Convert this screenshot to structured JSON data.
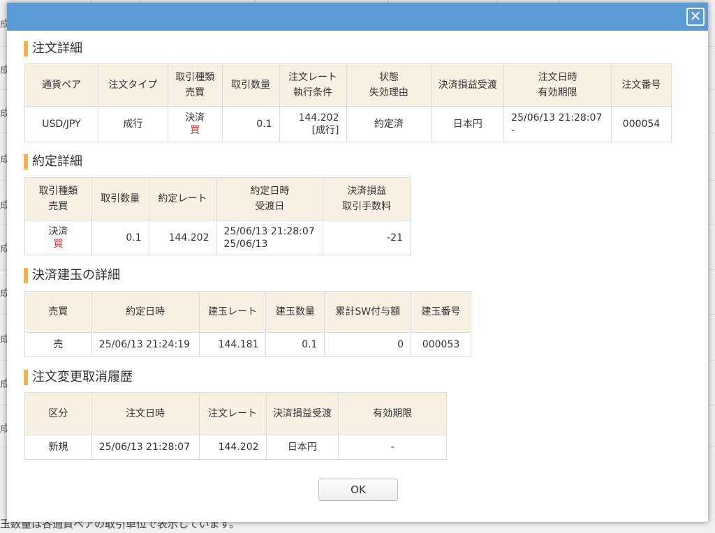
{
  "modal": {
    "close_glyph": "✕",
    "ok_label": "OK"
  },
  "background": {
    "left_glyph": "成",
    "footer_text": "玉数量は各通貨ペアの取引単位で表示しています。"
  },
  "order_detail": {
    "title": "注文詳細",
    "headers": [
      [
        "通貨ペア"
      ],
      [
        "注文タイプ"
      ],
      [
        "取引種類",
        "売買"
      ],
      [
        "取引数量"
      ],
      [
        "注文レート",
        "執行条件"
      ],
      [
        "状態",
        "失効理由"
      ],
      [
        "決済損益受渡"
      ],
      [
        "注文日時",
        "有効期限"
      ],
      [
        "注文番号"
      ]
    ],
    "row": {
      "pair": "USD/JPY",
      "type": "成行",
      "trade_kind": "決済",
      "side": "買",
      "quantity": "0.1",
      "rate": "144.202",
      "condition": "[成行]",
      "status": "約定済",
      "settlement_currency": "日本円",
      "order_datetime": "25/06/13 21:28:07",
      "expiry": "-",
      "order_no": "000054"
    }
  },
  "execution_detail": {
    "title": "約定詳細",
    "headers": [
      [
        "取引種類",
        "売買"
      ],
      [
        "取引数量"
      ],
      [
        "約定レート"
      ],
      [
        "約定日時",
        "受渡日"
      ],
      [
        "決済損益",
        "取引手数料"
      ]
    ],
    "row": {
      "trade_kind": "決済",
      "side": "買",
      "quantity": "0.1",
      "rate": "144.202",
      "exec_datetime": "25/06/13 21:28:07",
      "delivery_date": "25/06/13",
      "pnl": "-21"
    }
  },
  "position_detail": {
    "title": "決済建玉の詳細",
    "headers": [
      "売買",
      "約定日時",
      "建玉レート",
      "建玉数量",
      "累計SW付与額",
      "建玉番号"
    ],
    "row": {
      "side": "売",
      "exec_datetime": "25/06/13 21:24:19",
      "rate": "144.181",
      "quantity": "0.1",
      "swap": "0",
      "position_no": "000053"
    }
  },
  "history": {
    "title": "注文変更取消履歴",
    "headers": [
      "区分",
      "注文日時",
      "注文レート",
      "決済損益受渡",
      "有効期限"
    ],
    "row": {
      "kind": "新規",
      "order_datetime": "25/06/13 21:28:07",
      "rate": "144.202",
      "settlement_currency": "日本円",
      "expiry": "-"
    }
  },
  "colors": {
    "header_bar": "#5b9bd5",
    "section_accent": "#f0b54a",
    "table_header_bg": "#f8f0e3",
    "buy": "#d0312d",
    "sell": "#3a86c8",
    "negative": "#d0312d"
  }
}
